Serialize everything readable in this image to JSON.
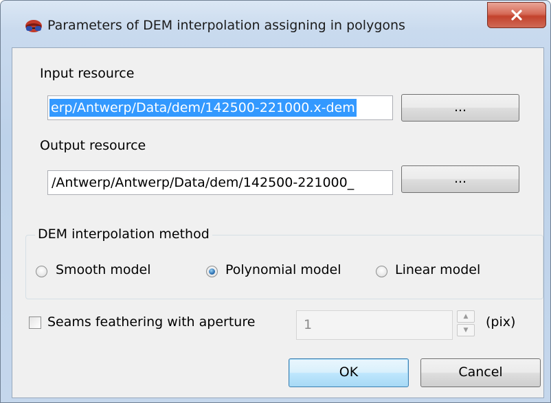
{
  "window": {
    "title": "Parameters of DEM interpolation assigning in polygons",
    "close_symbol": "X",
    "icon": "app-glasses-icon",
    "colors": {
      "titlebar": "#c9daee",
      "close_button": "#c3422d",
      "client_bg": "#f0f0f0",
      "selection": "#3399ff"
    }
  },
  "input_resource": {
    "label": "Input resource",
    "value": "erp/Antwerp/Data/dem/142500-221000.x-dem",
    "browse_label": "..."
  },
  "output_resource": {
    "label": "Output resource",
    "value": "/Antwerp/Antwerp/Data/dem/142500-221000_",
    "browse_label": "..."
  },
  "interpolation": {
    "group_label": "DEM interpolation method",
    "options": [
      {
        "label": "Smooth model",
        "selected": false
      },
      {
        "label": "Polynomial model",
        "selected": true
      },
      {
        "label": "Linear model",
        "selected": false
      }
    ]
  },
  "seams": {
    "checkbox_label": "Seams feathering with aperture",
    "checked": false,
    "aperture_value": "1",
    "unit": "(pix)"
  },
  "buttons": {
    "ok": "OK",
    "cancel": "Cancel"
  }
}
